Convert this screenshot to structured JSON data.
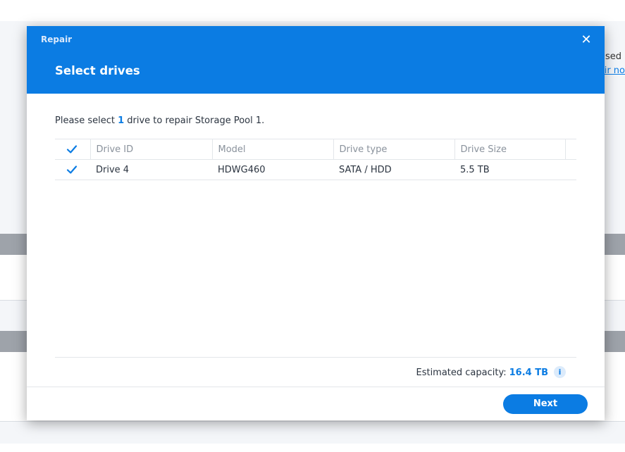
{
  "background": {
    "text_fragment_1": "sed",
    "link_fragment": "ir no"
  },
  "dialog": {
    "window_title": "Repair",
    "step_title": "Select drives",
    "close_icon": "close-icon",
    "instruction_prefix": "Please select ",
    "instruction_count": "1",
    "instruction_suffix": " drive to repair Storage Pool 1.",
    "table": {
      "columns": [
        "Drive ID",
        "Model",
        "Drive type",
        "Drive Size"
      ],
      "rows": [
        {
          "drive_id": "Drive 4",
          "model": "HDWG460",
          "drive_type": "SATA / HDD",
          "drive_size": "5.5 TB",
          "checked": true
        }
      ],
      "select_all_checked": true
    },
    "capacity_label": "Estimated capacity:",
    "capacity_value": "16.4 TB",
    "info_icon_glyph": "i",
    "next_label": "Next"
  },
  "colors": {
    "accent": "#0b7ce3",
    "header_bg": "#0b7ce3",
    "background_pane": "#f4f6f9",
    "background_band": "#9ea3aa"
  }
}
